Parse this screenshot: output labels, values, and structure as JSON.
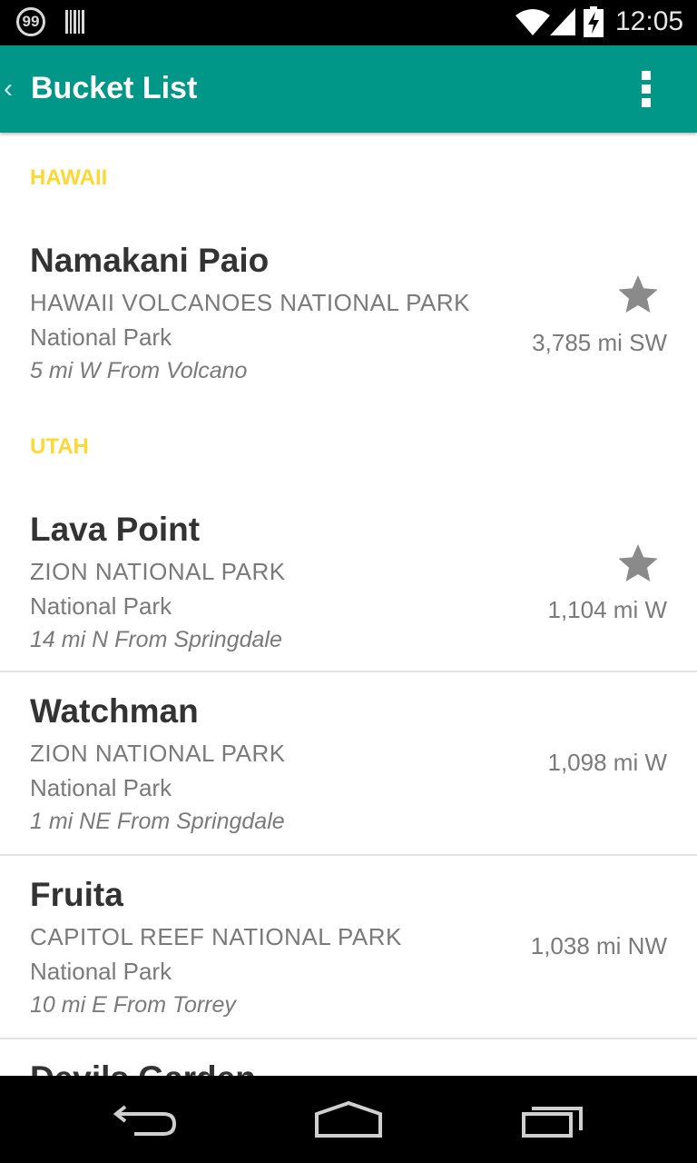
{
  "status_bar": {
    "notification_count": "99",
    "time": "12:05",
    "icons": [
      "barcode-icon",
      "wifi-icon",
      "signal-icon",
      "battery-charging-icon"
    ]
  },
  "action_bar": {
    "title": "Bucket List",
    "back_icon": "chevron-left-icon",
    "menu_icon": "overflow-menu-icon"
  },
  "sections": [
    {
      "header": "HAWAII",
      "items": [
        {
          "name": "Namakani Paio",
          "park": "HAWAII VOLCANOES NATIONAL PARK",
          "type": "National Park",
          "direction": "5 mi W From Volcano",
          "distance": "3,785 mi SW",
          "starred": true
        }
      ]
    },
    {
      "header": "UTAH",
      "items": [
        {
          "name": "Lava Point",
          "park": "ZION NATIONAL PARK",
          "type": "National Park",
          "direction": "14 mi N From Springdale",
          "distance": "1,104 mi W",
          "starred": true
        },
        {
          "name": "Watchman",
          "park": "ZION NATIONAL PARK",
          "type": "National Park",
          "direction": "1 mi NE From Springdale",
          "distance": "1,098 mi W",
          "starred": false
        },
        {
          "name": "Fruita",
          "park": "CAPITOL REEF NATIONAL PARK",
          "type": "National Park",
          "direction": "10 mi E From Torrey",
          "distance": "1,038 mi NW",
          "starred": false
        },
        {
          "name": "Devils Garden",
          "park": "",
          "type": "",
          "direction": "",
          "distance": "",
          "starred": false
        }
      ]
    }
  ],
  "nav_bar": {
    "icons": [
      "back-icon",
      "home-icon",
      "recent-apps-icon"
    ]
  },
  "colors": {
    "action_bar": "#009688",
    "section_header": "#fdd835",
    "primary_text": "#333333",
    "secondary_text": "#7a7a7a",
    "star": "#8a8a8a"
  }
}
